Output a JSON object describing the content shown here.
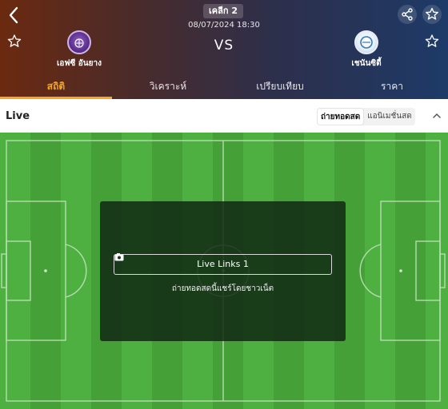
{
  "header": {
    "league": "เคลีก 2",
    "datetime": "08/07/2024 18:30",
    "vs": "VS",
    "home_team": "เอฟซี อันยาง",
    "away_team": "เชนันซิตี้",
    "icons": {
      "back": "back-arrow-icon",
      "share": "share-icon",
      "favorite": "star-icon"
    }
  },
  "tabs": [
    {
      "label": "สถิติ",
      "active": true
    },
    {
      "label": "วิเคราะห์",
      "active": false
    },
    {
      "label": "เปรียบเทียบ",
      "active": false
    },
    {
      "label": "ราคา",
      "active": false
    }
  ],
  "live": {
    "title": "Live",
    "segments": [
      "ถ่ายทอดสด",
      "แอนิเมชั่นสด"
    ],
    "active_segment": "ถ่ายทอดสด",
    "link_label": "Live Links 1",
    "note": "ถ่ายทอดสดนี้แชร์โดยชาวเน็ต"
  },
  "colors": {
    "accent": "#f5a623",
    "pitch_light": "#4aa83a",
    "pitch_dark": "#3f9a31"
  }
}
